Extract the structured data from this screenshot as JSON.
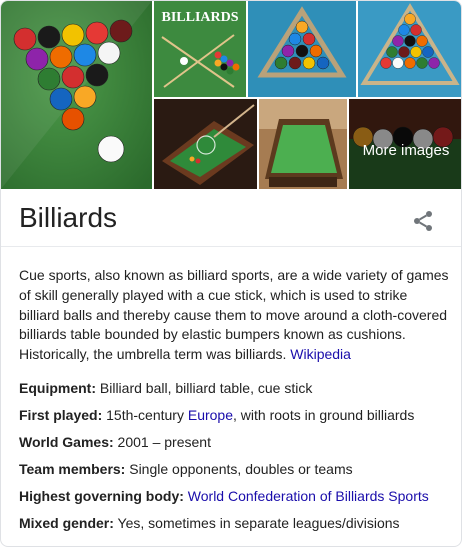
{
  "images": {
    "logo_text": "BILLIARDS",
    "more_label": "More images"
  },
  "entity": {
    "title": "Billiards"
  },
  "icons": {
    "share": "share-icon"
  },
  "description": {
    "text": "Cue sports, also known as billiard sports, are a wide variety of games of skill generally played with a cue stick, which is used to strike billiard balls and thereby cause them to move around a cloth-covered billiards table bounded by elastic bumpers known as cushions. Historically, the umbrella term was billiards.",
    "source_link": "Wikipedia"
  },
  "facts": [
    {
      "label": "Equipment:",
      "value": "Billiard ball, billiard table, cue stick"
    },
    {
      "label": "First played:",
      "value_pre": "15th-century",
      "link": "Europe",
      "value_post": ", with roots in ground billiards"
    },
    {
      "label": "World Games:",
      "value": "2001 – present"
    },
    {
      "label": "Team members:",
      "value": "Single opponents, doubles or teams"
    },
    {
      "label": "Highest governing body:",
      "link": "World Confederation of Billiards Sports"
    },
    {
      "label": "Mixed gender:",
      "value": "Yes, sometimes in separate leagues/divisions"
    }
  ],
  "colors": {
    "link": "#1a0dab",
    "felt_green": "#2e7d3a",
    "felt_blue": "#2f8fb8"
  }
}
